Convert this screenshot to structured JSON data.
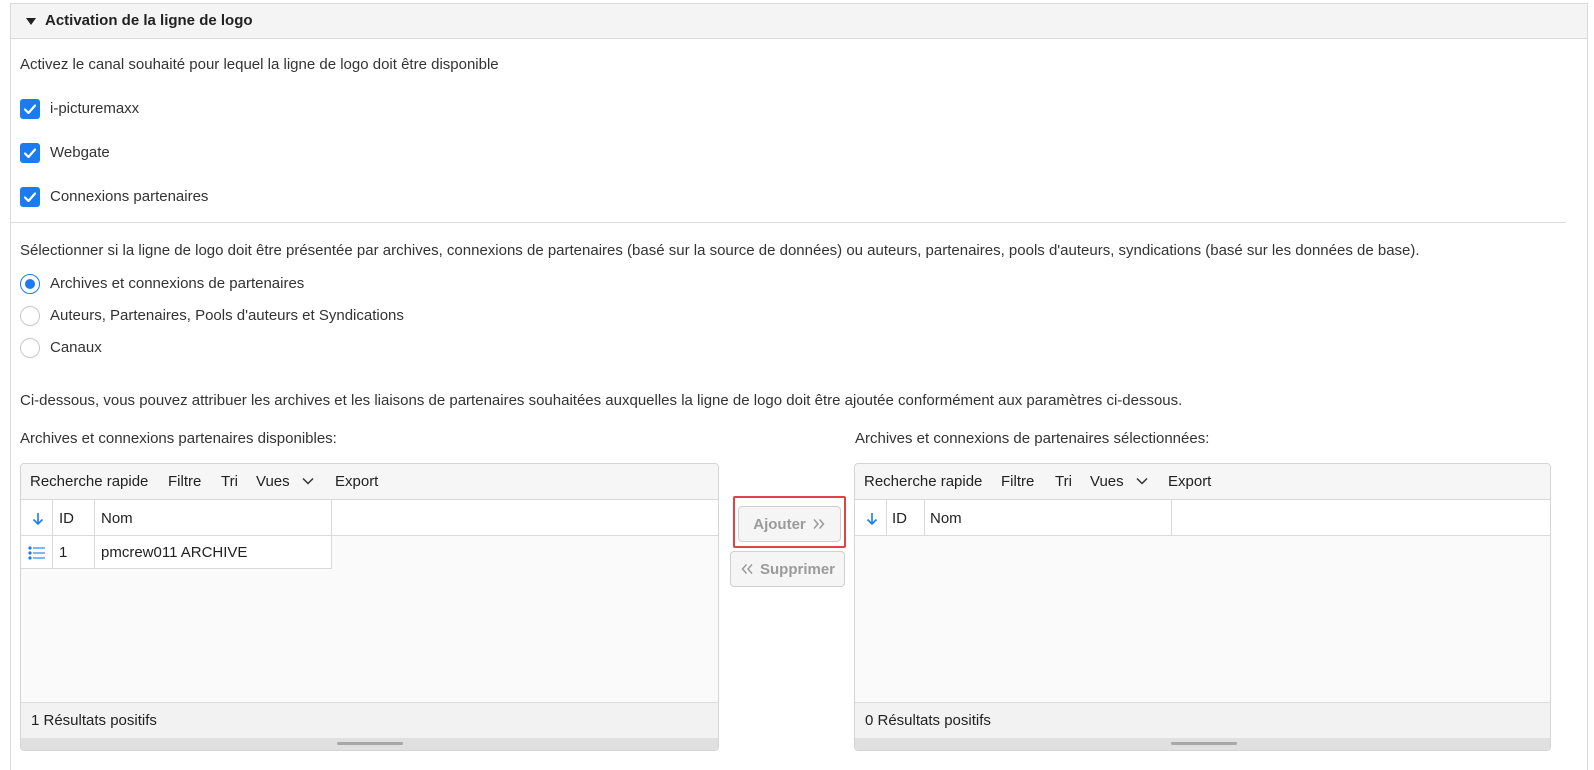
{
  "section": {
    "title": "Activation de la ligne de logo"
  },
  "channels": {
    "intro": "Activez le canal souhaité pour lequel la ligne de logo doit être disponible",
    "items": [
      {
        "label": "i-picturemaxx",
        "checked": true
      },
      {
        "label": "Webgate",
        "checked": true
      },
      {
        "label": "Connexions partenaires",
        "checked": true
      }
    ]
  },
  "presentation": {
    "intro": "Sélectionner si la ligne de logo doit être présentée par archives, connexions de partenaires (basé sur la source de données) ou auteurs, partenaires, pools d'auteurs, syndications (basé sur les données de base).",
    "options": [
      {
        "label": "Archives et connexions de partenaires",
        "selected": true
      },
      {
        "label": "Auteurs, Partenaires, Pools d'auteurs et Syndications",
        "selected": false
      },
      {
        "label": "Canaux",
        "selected": false
      }
    ]
  },
  "assignment": {
    "intro": "Ci-dessous, vous pouvez attribuer les archives et les liaisons de partenaires souhaitées auxquelles la ligne de logo doit être ajoutée conformément aux paramètres ci-dessous.",
    "available_label": "Archives et connexions partenaires disponibles:",
    "selected_label": "Archives et connexions de partenaires sélectionnées:"
  },
  "toolbar": {
    "quick_search": "Recherche rapide",
    "filter": "Filtre",
    "sort": "Tri",
    "views": "Vues",
    "export": "Export"
  },
  "columns": {
    "id": "ID",
    "name": "Nom"
  },
  "available_grid": {
    "rows": [
      {
        "id": "1",
        "name": "pmcrew011 ARCHIVE"
      }
    ],
    "footer": "1 Résultats positifs"
  },
  "selected_grid": {
    "rows": [],
    "footer": "0 Résultats positifs"
  },
  "buttons": {
    "add": "Ajouter",
    "remove": "Supprimer"
  },
  "colors": {
    "accent": "#1a7cf0",
    "highlight": "#e0424a"
  }
}
